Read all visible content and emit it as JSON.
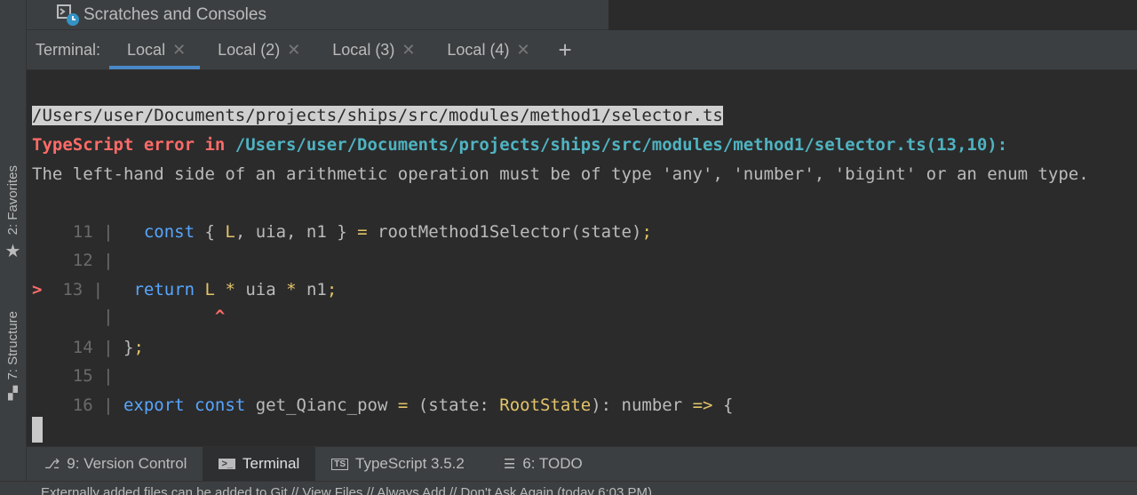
{
  "left_toolbar": {
    "favorites_label": "2: Favorites",
    "structure_label": "7: Structure"
  },
  "title_bar": {
    "title": "Scratches and Consoles",
    "icon": "scratches-icon"
  },
  "terminal_tabs": {
    "label": "Terminal:",
    "tabs": [
      {
        "label": "Local",
        "active": true
      },
      {
        "label": "Local (2)",
        "active": false
      },
      {
        "label": "Local (3)",
        "active": false
      },
      {
        "label": "Local (4)",
        "active": false
      }
    ],
    "close_glyph": "✕",
    "add_glyph": "+"
  },
  "terminal": {
    "path_line": "/Users/user/Documents/projects/ships/src/modules/method1/selector.ts",
    "error_prefix": "TypeScript error in ",
    "error_location": "/Users/user/Documents/projects/ships/src/modules/method1/selector.ts(13,10):",
    "error_message": "The left-hand side of an arithmetic operation must be of type 'any', 'number', 'bigint' or an enum type.",
    "code_lines": [
      {
        "num": "11",
        "marker": "",
        "code": "const { L, uia, n1 } = rootMethod1Selector(state);"
      },
      {
        "num": "12",
        "marker": "",
        "code": ""
      },
      {
        "num": "13",
        "marker": ">",
        "code": "return L * uia * n1;"
      },
      {
        "num": "",
        "marker": "",
        "code": "^"
      },
      {
        "num": "14",
        "marker": "",
        "code": "};"
      },
      {
        "num": "15",
        "marker": "",
        "code": ""
      },
      {
        "num": "16",
        "marker": "",
        "code": "export const get_Qianc_pow = (state: RootState): number => {"
      }
    ]
  },
  "bottom_tabs": [
    {
      "label": "9: Version Control",
      "icon": "version-control-icon",
      "active": false
    },
    {
      "label": "Terminal",
      "icon": "terminal-icon",
      "active": true
    },
    {
      "label": "TypeScript 3.5.2",
      "icon": "typescript-icon",
      "active": false
    },
    {
      "label": "6: TODO",
      "icon": "todo-icon",
      "active": false
    }
  ],
  "status_bar": {
    "message": "Externally added files can be added to Git // View Files // Always Add // Don't Ask Again (today 6:03 PM)"
  },
  "colors": {
    "error_red": "#ff6b68",
    "path_teal": "#4fb3c1",
    "keyword_blue": "#57a6ff",
    "operator_yellow": "#e3c46a",
    "tab_underline": "#4a88c7"
  }
}
